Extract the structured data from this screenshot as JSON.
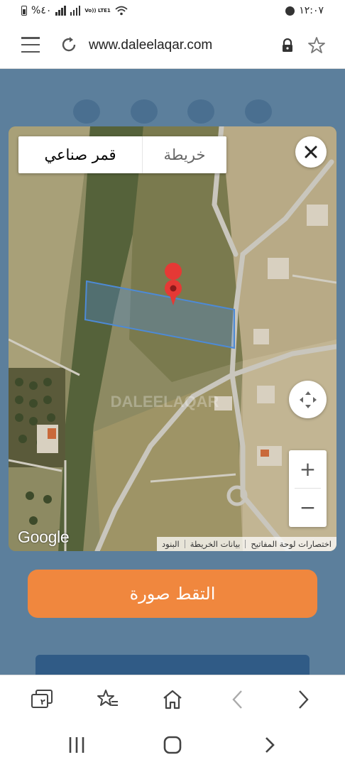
{
  "status_bar": {
    "battery": "%٤٠",
    "carrier": "Vo)) LTE1",
    "time": "١٢:٠٧"
  },
  "browser": {
    "url": "www.daleelaqar.com",
    "icons": [
      "menu-icon",
      "reload-icon",
      "lock-icon",
      "star-icon"
    ]
  },
  "map": {
    "tab_satellite": "قمر صناعي",
    "tab_map": "خريطة",
    "active_tab": "satellite",
    "watermark": "DALEELAQAR",
    "logo": "Google",
    "attribution": {
      "shortcuts": "اختصارات لوحة المفاتيح",
      "map_data": "بيانات الخريطة",
      "terms": "البنود"
    },
    "zoom_in": "+",
    "zoom_out": "−",
    "colors": {
      "parcel": "#4d8ad6",
      "pin": "#e53935"
    }
  },
  "actions": {
    "capture_label": "التقط صورة"
  },
  "toolbar": {
    "tabs_count": "٢",
    "icons": [
      "tabs-icon",
      "bookmarks-icon",
      "home-icon",
      "back-icon",
      "forward-icon"
    ]
  },
  "colors": {
    "page_bg": "#5c7f9c",
    "accent": "#f0873e"
  }
}
